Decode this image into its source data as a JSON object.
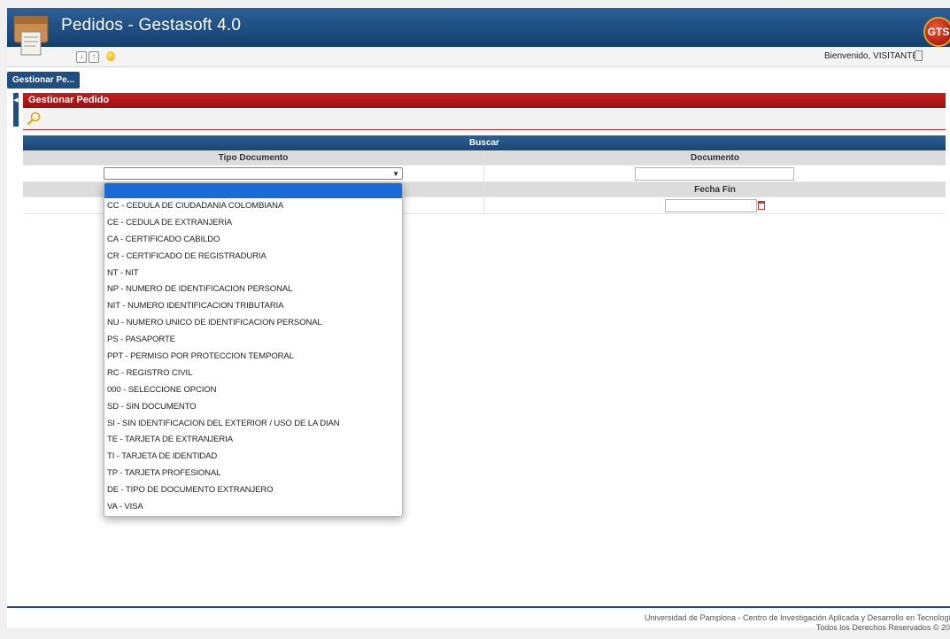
{
  "header": {
    "title": "Pedidos - Gestasoft 4.0",
    "brand_logo_text": "GTS"
  },
  "toolbar": {
    "welcome_text": "Bienvenido, VISITANTE"
  },
  "module_tab": {
    "label": "Gestionar Pe..."
  },
  "section": {
    "title": "Gestionar Pedido"
  },
  "form": {
    "title": "Buscar",
    "fields": {
      "tipo_documento_label": "Tipo Documento",
      "documento_label": "Documento",
      "fecha_fin_label": "Fecha Fin",
      "tipo_documento_value": "",
      "documento_value": "",
      "fecha_fin_value": ""
    }
  },
  "dropdown": {
    "options": [
      "CC - CEDULA DE CIUDADANIA COLOMBIANA",
      "CE - CEDULA DE EXTRANJERIA",
      "CA - CERTIFICADO CABILDO",
      "CR - CERTIFICADO DE REGISTRADURIA",
      "NT - NIT",
      "NP - NUMERO DE IDENTIFICACION PERSONAL",
      "NIT - NUMERO IDENTIFICACION TRIBUTARIA",
      "NU - NUMERO UNICO DE IDENTIFICACION PERSONAL",
      "PS - PASAPORTE",
      "PPT - PERMISO POR PROTECCION TEMPORAL",
      "RC - REGISTRO CIVIL",
      "000 - SELECCIONE OPCION",
      "SD - SIN DOCUMENTO",
      "SI - SIN IDENTIFICACION DEL EXTERIOR / USO DE LA DIAN",
      "TE - TARJETA DE EXTRANJERIA",
      "TI - TARJETA DE IDENTIDAD",
      "TP - TARJETA PROFESIONAL",
      "DE - TIPO DE DOCUMENTO EXTRANJERO",
      "VA - VISA"
    ]
  },
  "footer": {
    "line1": "Universidad de Pamplona - Centro de Investigación Aplicada y Desarrollo en Tecnologías de Informaci",
    "line2": "Todos los Derechos Reservados © 20"
  }
}
